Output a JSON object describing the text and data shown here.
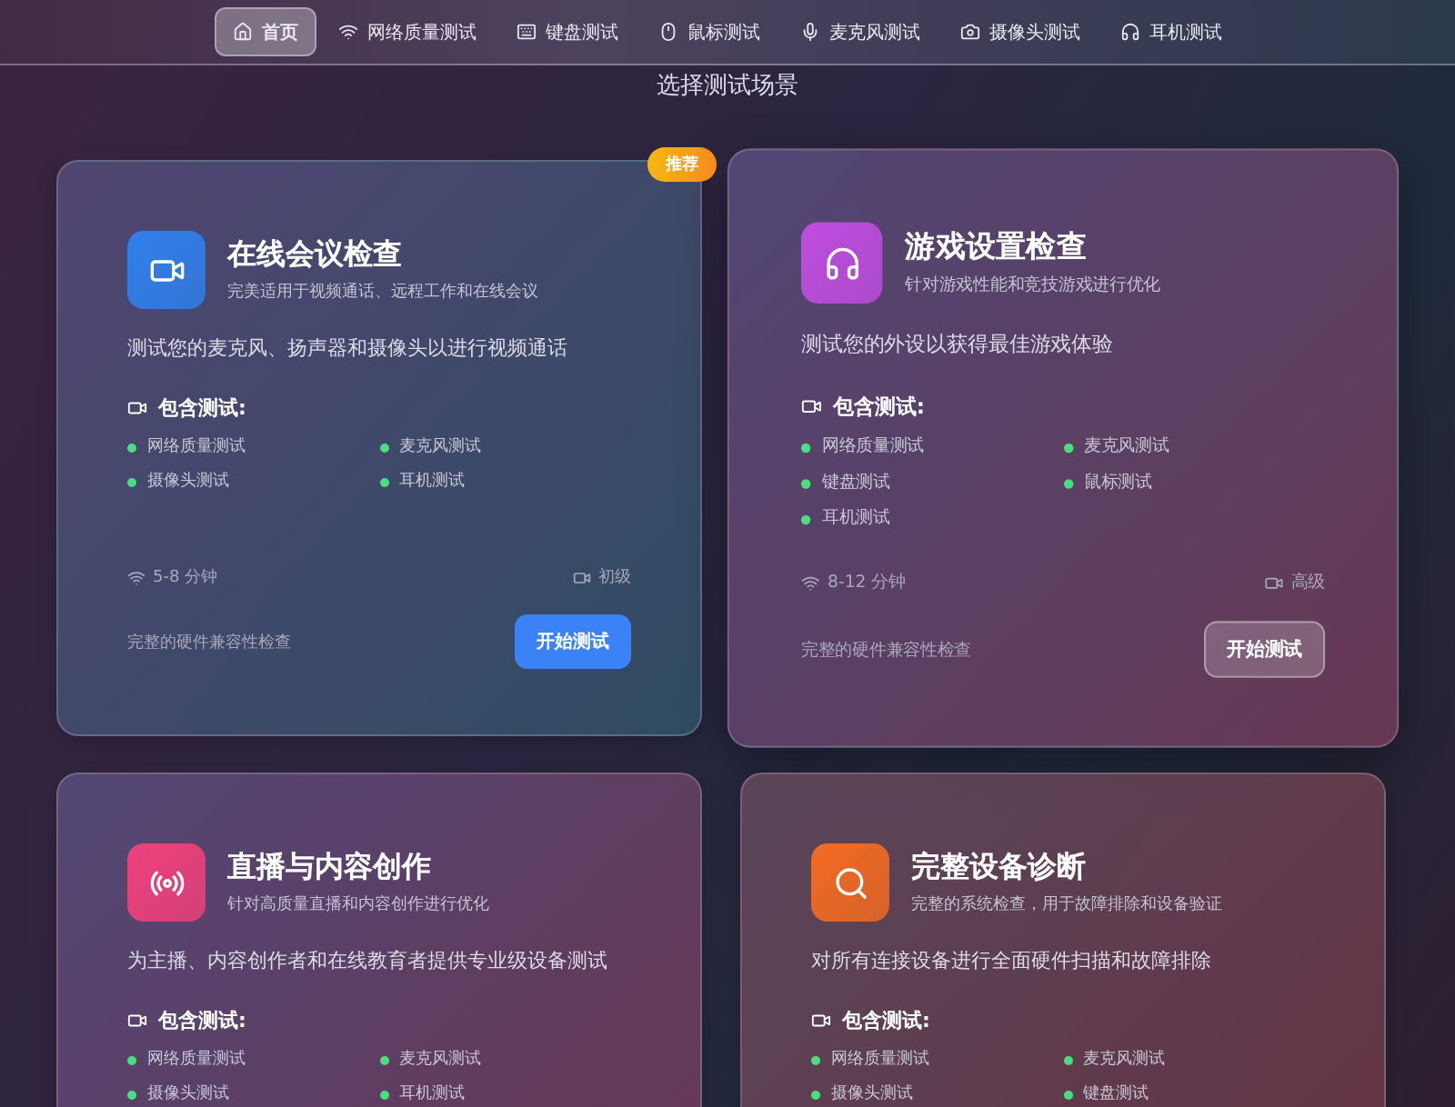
{
  "nav": [
    {
      "label": "首页",
      "selected": true
    },
    {
      "label": "网络质量测试",
      "selected": false
    },
    {
      "label": "键盘测试",
      "selected": false
    },
    {
      "label": "鼠标测试",
      "selected": false
    },
    {
      "label": "麦克风测试",
      "selected": false
    },
    {
      "label": "摄像头测试",
      "selected": false
    },
    {
      "label": "耳机测试",
      "selected": false
    }
  ],
  "heading": "选择测试场景",
  "cards": [
    {
      "title": "在线会议检查",
      "subtitle": "完美适用于视频通话、远程工作和在线会议",
      "color": "#2f80ed",
      "hovered": false,
      "badge": "推荐",
      "description": "测试您的麦克风、扬声器和摄像头以进行视频通话",
      "tests_label": "包含测试:",
      "tests": [
        "网络质量测试",
        "麦克风测试",
        "摄像头测试",
        "耳机测试"
      ],
      "duration": "5-8 分钟",
      "level_label": "初级",
      "footer": "完整的硬件兼容性检查",
      "button": {
        "label": "开始测试",
        "kind": "primary"
      }
    },
    {
      "title": "游戏设置检查",
      "subtitle": "针对游戏性能和竞技游戏进行优化",
      "color": "#c04de0",
      "hovered": true,
      "description": "测试您的外设以获得最佳游戏体验",
      "tests_label": "包含测试:",
      "tests": [
        "网络质量测试",
        "麦克风测试",
        "键盘测试",
        "鼠标测试",
        "耳机测试"
      ],
      "duration": "8-12 分钟",
      "level_label": "高级",
      "footer": "完整的硬件兼容性检查",
      "button": {
        "label": "开始测试",
        "kind": "ghost"
      }
    },
    {
      "title": "直播与内容创作",
      "subtitle": "针对高质量直播和内容创作进行优化",
      "color": "#f0407a",
      "hovered": false,
      "description": "为主播、内容创作者和在线教育者提供专业级设备测试",
      "tests_label": "包含测试:",
      "tests": [
        "网络质量测试",
        "麦克风测试",
        "摄像头测试",
        "耳机测试"
      ]
    },
    {
      "title": "完整设备诊断",
      "subtitle": "完整的系统检查，用于故障排除和设备验证",
      "color": "#f36b21",
      "hovered": false,
      "description": "对所有连接设备进行全面硬件扫描和故障排除",
      "tests_label": "包含测试:",
      "tests": [
        "网络质量测试",
        "麦克风测试",
        "摄像头测试",
        "键盘测试"
      ]
    }
  ]
}
